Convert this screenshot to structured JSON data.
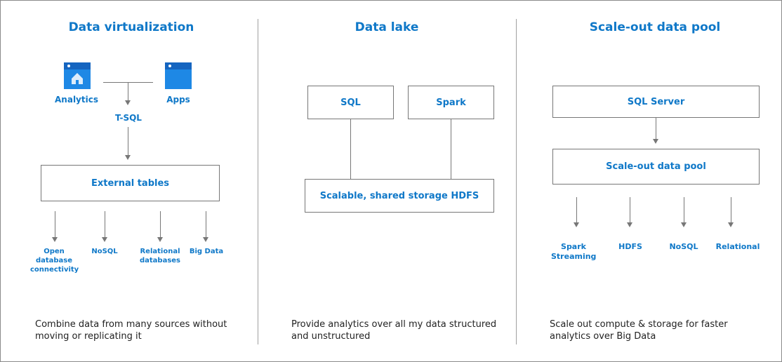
{
  "columns": [
    {
      "title": "Data virtualization",
      "icons": [
        {
          "label": "Analytics",
          "icon": "analytics-home-icon"
        },
        {
          "label": "Apps",
          "icon": "apps-window-icon"
        }
      ],
      "protocol": "T-SQL",
      "box": "External tables",
      "sources": [
        "Open database connectivity",
        "NoSQL",
        "Relational databases",
        "Big Data"
      ],
      "description": "Combine data from many sources without moving or replicating it"
    },
    {
      "title": "Data lake",
      "top_boxes": [
        "SQL",
        "Spark"
      ],
      "storage_box": "Scalable, shared storage HDFS",
      "description": "Provide analytics over all my data structured and unstructured"
    },
    {
      "title": "Scale-out data pool",
      "top_box": "SQL Server",
      "pool_box": "Scale-out data pool",
      "targets": [
        "Spark Streaming",
        "HDFS",
        "NoSQL",
        "Relational"
      ],
      "description": "Scale out compute & storage for faster analytics over Big Data"
    }
  ],
  "colors": {
    "accent": "#0f78c8",
    "icon_blue": "#1e88e5",
    "line": "#777777"
  }
}
